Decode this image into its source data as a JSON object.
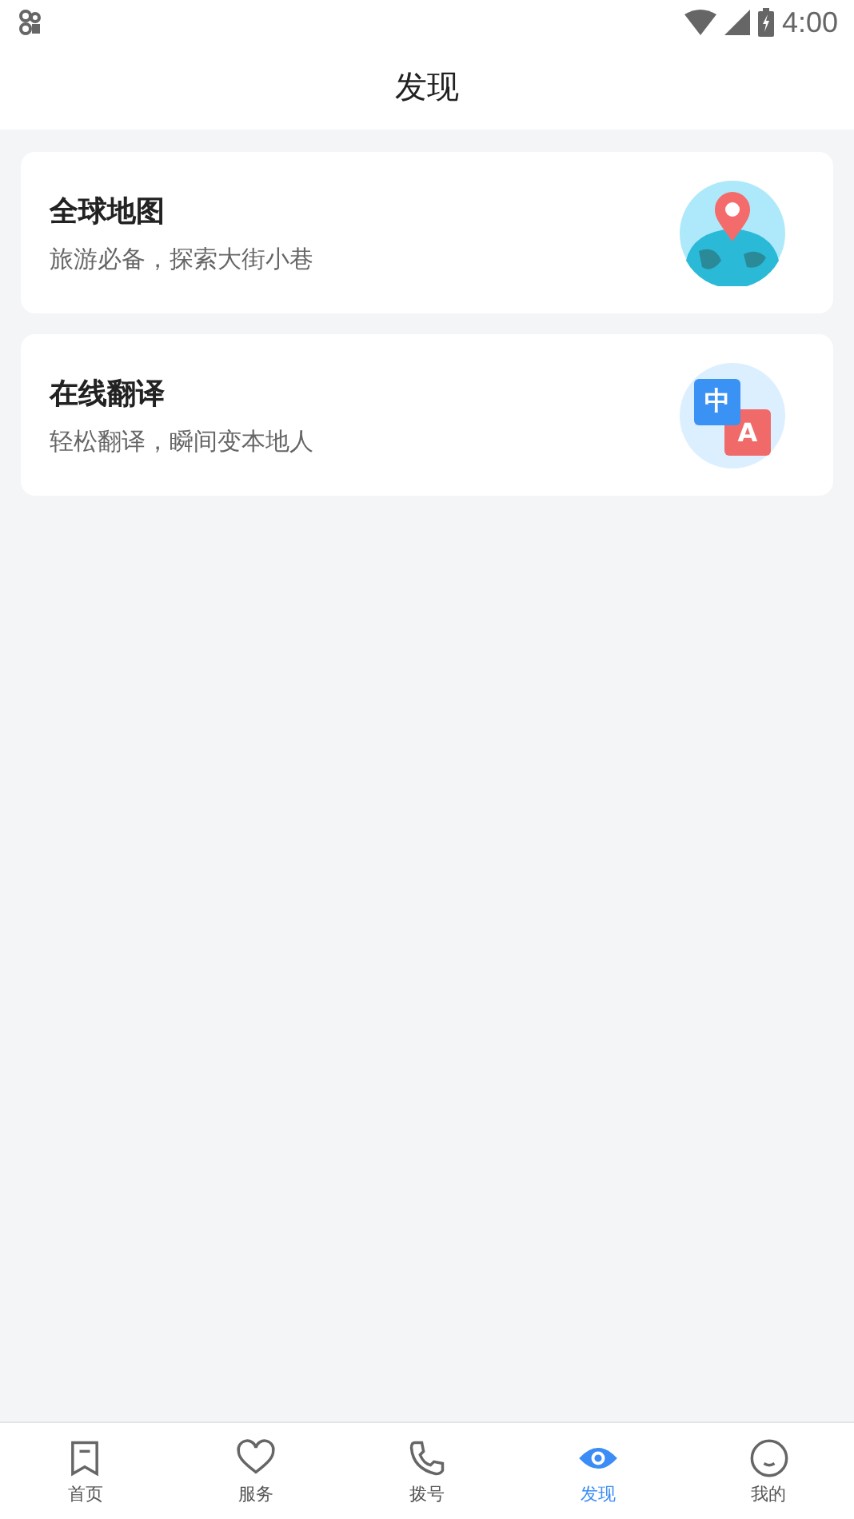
{
  "status_bar": {
    "time": "4:00"
  },
  "header": {
    "title": "发现"
  },
  "cards": [
    {
      "kind": "map",
      "title": "全球地图",
      "subtitle": "旅游必备，探索大街小巷"
    },
    {
      "kind": "translate",
      "title": "在线翻译",
      "subtitle": "轻松翻译，瞬间变本地人",
      "glyphs": [
        "中",
        "A"
      ]
    }
  ],
  "tabs": [
    {
      "kind": "home",
      "label": "首页",
      "selected": false
    },
    {
      "kind": "heart",
      "label": "服务",
      "selected": false
    },
    {
      "kind": "phone",
      "label": "拨号",
      "selected": false
    },
    {
      "kind": "eye",
      "label": "发现",
      "selected": true
    },
    {
      "kind": "smile",
      "label": "我的",
      "selected": false
    }
  ]
}
